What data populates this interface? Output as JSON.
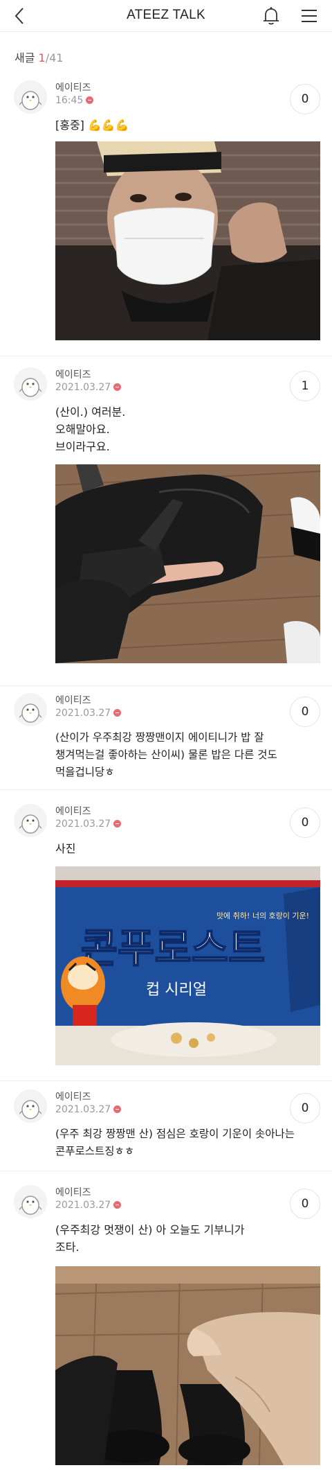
{
  "header": {
    "title": "ATEEZ TALK"
  },
  "counter": {
    "label": "새글",
    "current": "1",
    "separator": "/",
    "total": "41"
  },
  "posts": [
    {
      "author": "에이티즈",
      "time": "16:45",
      "count": "0",
      "text": "[홍중] 💪💪💪",
      "has_photo": true
    },
    {
      "author": "에이티즈",
      "time": "2021.03.27",
      "count": "1",
      "text": "(산이.) 여러분.\n오해말아요.\n브이라구요.",
      "has_photo": true
    },
    {
      "author": "에이티즈",
      "time": "2021.03.27",
      "count": "0",
      "text": "(산이가 우주최강 짱짱맨이지 에이티니가 밥 잘\n챙겨먹는걸 좋아하는 산이씨) 물론 밥은 다른 것도\n먹을겁니당ㅎ",
      "has_photo": false
    },
    {
      "author": "에이티즈",
      "time": "2021.03.27",
      "count": "0",
      "text": "사진",
      "has_photo": true,
      "photo_text": {
        "brand": "콘푸로스트",
        "caption": "컵 시리얼",
        "tagline": "맛에 취하! 너의 호랑이 기운!"
      }
    },
    {
      "author": "에이티즈",
      "time": "2021.03.27",
      "count": "0",
      "text": "(우주 최강 짱짱맨 산) 점심은 호랑이 기운이 솟아나는\n콘푸로스트징ㅎㅎ",
      "has_photo": false
    },
    {
      "author": "에이티즈",
      "time": "2021.03.27",
      "count": "0",
      "text": "(우주최강 멋쟁이 산) 아 오늘도 기부니가\n조타.",
      "has_photo": true
    }
  ],
  "colors": {
    "accent": "#e05a67",
    "badge": "#e66b75"
  },
  "icons": {
    "back": "chevron-left-icon",
    "bell": "bell-icon",
    "menu": "hamburger-menu-icon",
    "avatar": "penguin-avatar-icon",
    "badge": "notification-dot-icon"
  }
}
